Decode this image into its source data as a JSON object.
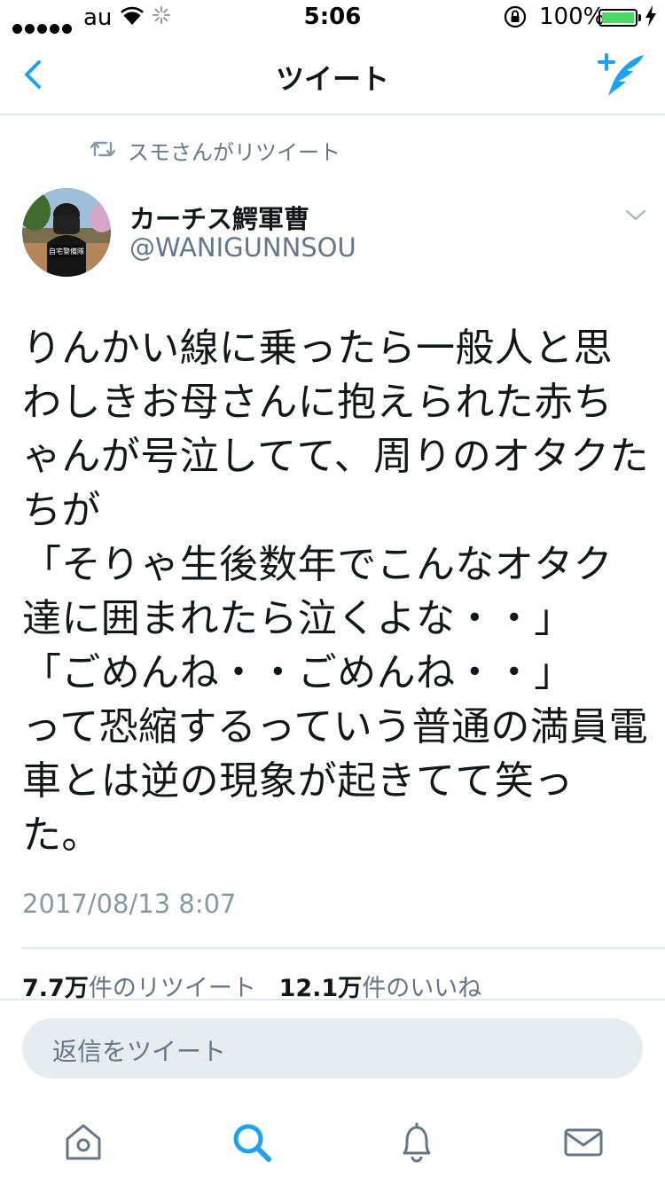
{
  "status_bar": {
    "carrier": "au",
    "time": "5:06",
    "battery": "100%",
    "battery_level": 1.0
  },
  "nav": {
    "title": "ツイート",
    "back_icon": "chevron-left-icon",
    "compose_icon": "compose-tweet-icon"
  },
  "retweet": {
    "text": "スモさんがリツイート"
  },
  "author": {
    "name": "カーチス鰐軍曹",
    "handle": "@WANIGUNNSOU",
    "avatar_text": "自宅警備隊"
  },
  "tweet": {
    "text": "りんかい線に乗ったら一般人と思\nわしきお母さんに抱えられた赤ち\nゃんが号泣してて、周りのオタクた\nちが\n「そりゃ生後数年でこんなオタク\n達に囲まれたら泣くよな・・」\n「ごめんね・・ごめんね・・」\nって恐縮するっていう普通の満員電\n車とは逆の現象が起きてて笑っ\nた。",
    "timestamp": "2017/08/13 8:07"
  },
  "stats": {
    "retweets": "7.7万",
    "retweets_label": "件のリツイート",
    "likes": "12.1万",
    "likes_label": "件のいいね"
  },
  "reply": {
    "placeholder": "返信をツイート"
  },
  "tabs": [
    "home-icon",
    "search-icon",
    "notifications-icon",
    "messages-icon"
  ],
  "colors": {
    "accent": "#1da1f2",
    "text": "#14171a",
    "secondary": "#657786",
    "muted": "#8899a6",
    "border": "#e1e8ed",
    "battery": "#4cd964"
  }
}
